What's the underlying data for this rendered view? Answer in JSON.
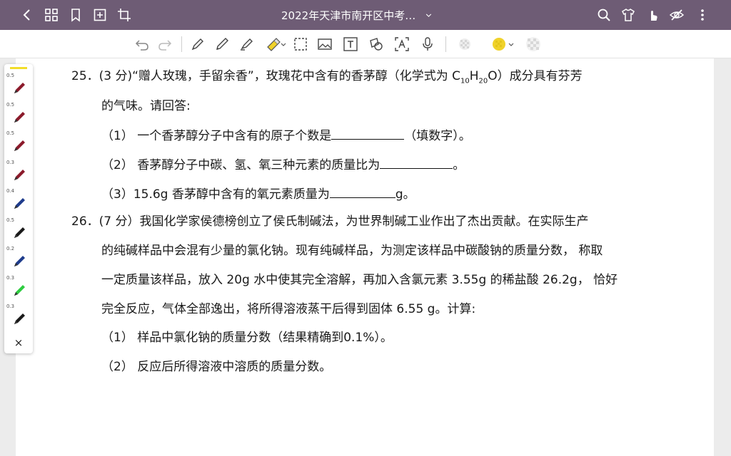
{
  "topbar": {
    "title": "2022年天津市南开区中考…",
    "icons": [
      "back-icon",
      "grid-icon",
      "bookmark-icon",
      "add-page-icon",
      "crop-icon",
      "chevron-down-icon",
      "search-icon",
      "shirt-icon",
      "touch-icon",
      "eye-off-icon",
      "more-icon"
    ]
  },
  "toolbar": {
    "icons": [
      "undo-icon",
      "redo-icon",
      "pen-icon",
      "pencil-icon",
      "marker-icon",
      "highlighter-icon",
      "lasso-icon",
      "image-icon",
      "text-icon",
      "shape-icon",
      "ocr-icon",
      "mic-icon",
      "eraser-icon",
      "color-picker-icon",
      "pattern-icon"
    ],
    "accent_color": "#f0d22a"
  },
  "penbar": {
    "pens": [
      {
        "size": "0.5",
        "color": "#8b1a2b"
      },
      {
        "size": "0.5",
        "color": "#8b1a2b"
      },
      {
        "size": "0.5",
        "color": "#8b1a2b"
      },
      {
        "size": "0.3",
        "color": "#8b1a2b"
      },
      {
        "size": "0.4",
        "color": "#1f3c8c"
      },
      {
        "size": "0.5",
        "color": "#1a1a1a"
      },
      {
        "size": "0.2",
        "color": "#1f3c8c"
      },
      {
        "size": "0.3",
        "color": "#2ecc40"
      },
      {
        "size": "0.3",
        "color": "#1a1a1a"
      }
    ],
    "close": "×"
  },
  "content": {
    "q25_line1_a": "25．(3 分)“赠人玫瑰，手留余香”，玫瑰花中含有的香茅醇（化学式为 C",
    "q25_sub1": "10",
    "q25_h": "H",
    "q25_sub2": "20",
    "q25_line1_b": "O）成分具有芬芳",
    "q25_line2": "的气味。请回答:",
    "q25_p1_a": "（1） 一个香茅醇分子中含有的原子个数是",
    "q25_p1_b": "（填数字）。",
    "q25_p2_a": "（2） 香茅醇分子中碳、氢、氧三种元素的质量比为",
    "q25_p2_b": "。",
    "q25_p3_a": "（3）15.6g 香茅醇中含有的氧元素质量为",
    "q25_p3_b": "g。",
    "q26_line1": "26．(7 分）我国化学家侯德榜创立了侯氏制碱法，为世界制碱工业作出了杰出贡献。在实际生产",
    "q26_line2": "的纯碱样品中会混有少量的氯化钠。现有纯碱样品，为测定该样品中碳酸钠的质量分数， 称取",
    "q26_line3": "一定质量该样品，放入 20g 水中使其完全溶解，再加入含氯元素 3.55g 的稀盐酸 26.2g， 恰好",
    "q26_line4": "完全反应，气体全部逸出，将所得溶液蒸干后得到固体 6.55 g。计算:",
    "q26_p1": "（1） 样品中氯化钠的质量分数（结果精确到0.1%）。",
    "q26_p2": "（2） 反应后所得溶液中溶质的质量分数。"
  }
}
